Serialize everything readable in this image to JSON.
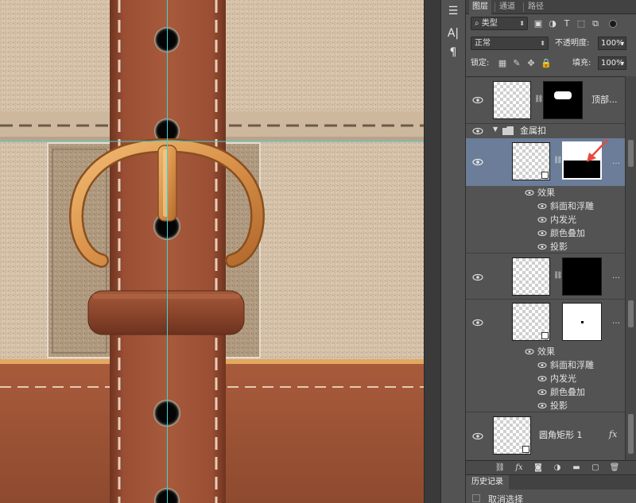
{
  "toolstrip": {
    "icons": [
      "arrange-icon",
      "character-icon",
      "paragraph-icon"
    ],
    "glyphs": [
      "☰",
      "A|",
      "¶"
    ]
  },
  "panel": {
    "tabs": [
      {
        "label": "图层",
        "active": true
      },
      {
        "label": "通道",
        "active": false
      },
      {
        "label": "路径",
        "active": false
      }
    ],
    "filter": {
      "label": "类型"
    },
    "blend_mode": "正常",
    "opacity": {
      "label": "不透明度:",
      "value": "100%"
    },
    "lock": {
      "label": "锁定:"
    },
    "fill": {
      "label": "填充:",
      "value": "100%"
    }
  },
  "layers": {
    "top": {
      "name": "顶部..."
    },
    "group": {
      "name": "金属扣"
    },
    "selected": {
      "effects_label": "效果",
      "effects": [
        "斜面和浮雕",
        "内发光",
        "颜色叠加",
        "投影"
      ]
    },
    "layer2": {},
    "layer3": {
      "effects_label": "效果",
      "effects": [
        "斜面和浮雕",
        "内发光",
        "颜色叠加",
        "投影"
      ]
    },
    "last": {
      "name": "圆角矩形 1",
      "fx": "fx"
    }
  },
  "history": {
    "tab": "历史记录",
    "item": "取消选择"
  },
  "colors": {
    "leather": "#9a4e33",
    "leather_dark": "#6e3420",
    "fabric": "#d8c5ae",
    "buckle": "#d9924a",
    "panel_bg": "#535353",
    "selected_row": "#6b7d98",
    "annotation_arrow": "#e8483d"
  }
}
